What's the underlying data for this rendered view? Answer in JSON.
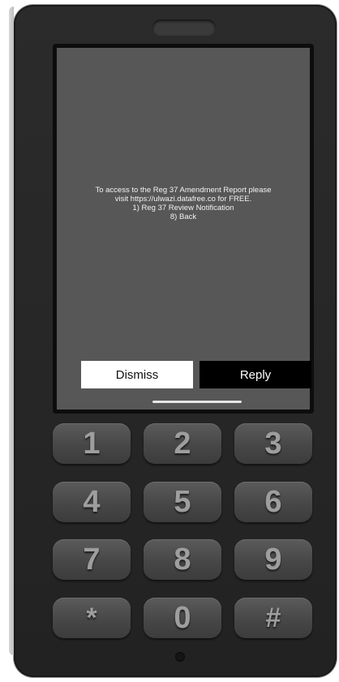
{
  "notification": {
    "lines": [
      "To access to the Reg 37 Amendment Report please",
      "visit https://ulwazi.datafree.co for FREE.",
      "1) Reg 37 Review Notification",
      "8) Back"
    ],
    "dismiss_label": "Dismiss",
    "reply_label": "Reply"
  },
  "keypad": {
    "keys": [
      "1",
      "2",
      "3",
      "4",
      "5",
      "6",
      "7",
      "8",
      "9",
      "*",
      "0",
      "#"
    ]
  },
  "colors": {
    "screen": "#575757",
    "phone_body": "#262626",
    "key": "#474747",
    "key_text": "#9e9e9e",
    "dismiss_bg": "#ffffff",
    "reply_bg": "#000000"
  }
}
